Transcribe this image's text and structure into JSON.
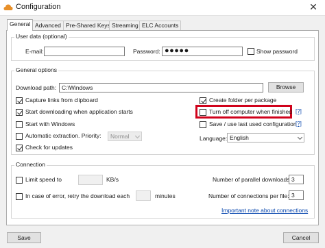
{
  "window": {
    "title": "Configuration",
    "close_glyph": "✕"
  },
  "tabs": [
    "General",
    "Advanced",
    "Pre-Shared Keys",
    "Streaming",
    "ELC Accounts"
  ],
  "user_data": {
    "legend": "User data (optional)",
    "email_label": "E-mail:",
    "email_value": "",
    "password_label": "Password:",
    "password_value": "●●●●●",
    "show_password_label": "Show password",
    "show_password_checked": false
  },
  "general_options": {
    "legend": "General options",
    "download_path_label": "Download path:",
    "download_path_value": "C:\\Windows",
    "browse_label": "Browse",
    "options": [
      {
        "label": "Capture links from clipboard",
        "checked": true
      },
      {
        "label": "Start downloading when application starts",
        "checked": true
      },
      {
        "label": "Start with Windows",
        "checked": false
      },
      {
        "label": "Automatic extraction. Priority:",
        "checked": false
      },
      {
        "label": "Check for updates",
        "checked": true
      }
    ],
    "priority_value": "Normal",
    "right_options": [
      {
        "label": "Create folder per package",
        "checked": true
      },
      {
        "label": "Turn off computer when finished",
        "checked": false,
        "help": "[?]"
      },
      {
        "label": "Save / use last used configuration",
        "checked": false,
        "help": "[?]"
      }
    ],
    "language_label": "Language:",
    "language_value": "English"
  },
  "connection": {
    "legend": "Connection",
    "limit_speed_label": "Limit speed to",
    "limit_speed_checked": false,
    "limit_speed_value": "",
    "speed_unit": "KB/s",
    "retry_label": "In case of error, retry the download each",
    "retry_checked": false,
    "retry_value": "",
    "retry_unit": "minutes",
    "parallel_label": "Number of parallel downloads:",
    "parallel_value": "3",
    "connections_label": "Number of connections per file:",
    "connections_value": "3",
    "note_link": "Important note about connections"
  },
  "footer": {
    "save_label": "Save",
    "cancel_label": "Cancel"
  },
  "colors": {
    "highlight": "#d0021b",
    "link": "#0645ad",
    "icon_orange": "#e8902a"
  },
  "icons": {
    "app": "cloud-icon",
    "checkmark": "checkmark-icon",
    "chevron": "chevron-down-icon"
  }
}
